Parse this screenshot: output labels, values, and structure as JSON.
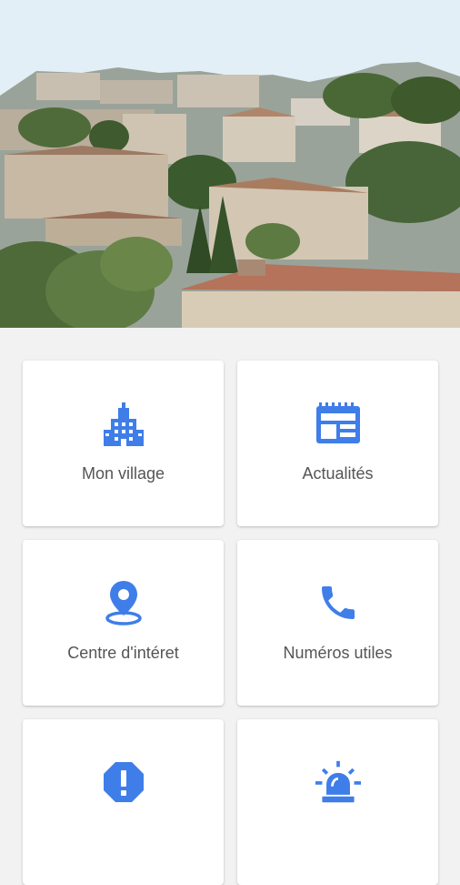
{
  "colors": {
    "accent": "#3f7ee8",
    "background": "#f2f2f2",
    "card": "#ffffff",
    "label": "#555555"
  },
  "hero": {
    "image": "village-panorama"
  },
  "tiles": [
    {
      "label": "Mon village",
      "icon": "city-buildings-icon"
    },
    {
      "label": "Actualités",
      "icon": "newspaper-icon"
    },
    {
      "label": "Centre d'intéret",
      "icon": "location-pin-icon"
    },
    {
      "label": "Numéros utiles",
      "icon": "phone-icon"
    },
    {
      "label": "",
      "icon": "alert-octagon-icon"
    },
    {
      "label": "",
      "icon": "siren-icon"
    }
  ]
}
